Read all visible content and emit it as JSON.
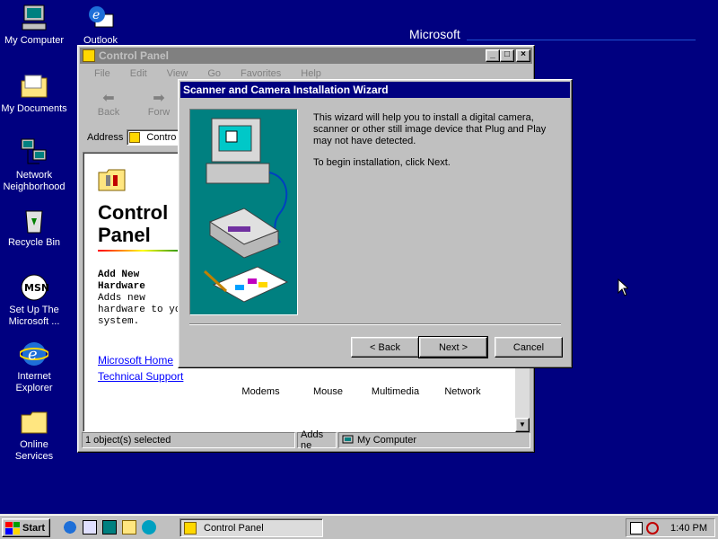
{
  "desktop": {
    "icons": [
      {
        "label": "My Computer"
      },
      {
        "label": "Outlook"
      },
      {
        "label": "My Documents"
      },
      {
        "label": "Network Neighborhood"
      },
      {
        "label": "Recycle Bin"
      },
      {
        "label": "Set Up The Microsoft ..."
      },
      {
        "label": "Internet Explorer"
      },
      {
        "label": "Online Services"
      }
    ],
    "brand": "Microsoft"
  },
  "control_panel": {
    "title": "Control Panel",
    "menu": [
      "File",
      "Edit",
      "View",
      "Go",
      "Favorites",
      "Help"
    ],
    "toolbar": {
      "back": "Back",
      "forward": "Forw"
    },
    "address_label": "Address",
    "address_value": "Contro",
    "heading": "Control Panel",
    "heading_line1": "Control",
    "heading_line2": "Panel",
    "selected_item": "Add New Hardware",
    "selected_desc": "Adds new hardware to your system.",
    "links": [
      "Microsoft Home",
      "Technical Support"
    ],
    "icons": [
      "Modems",
      "Mouse",
      "Multimedia",
      "Network"
    ],
    "status": {
      "objects": "1 object(s) selected",
      "desc": "Adds ne",
      "zone": "My Computer"
    }
  },
  "wizard": {
    "title": "Scanner and Camera Installation Wizard",
    "intro": "This wizard will help you to install a digital camera, scanner or other still image device that Plug and Play may not have detected.",
    "instruction": "To begin installation, click Next.",
    "buttons": {
      "back": "< Back",
      "next": "Next >",
      "cancel": "Cancel"
    }
  },
  "taskbar": {
    "start": "Start",
    "task": "Control Panel",
    "clock": "1:40 PM"
  }
}
